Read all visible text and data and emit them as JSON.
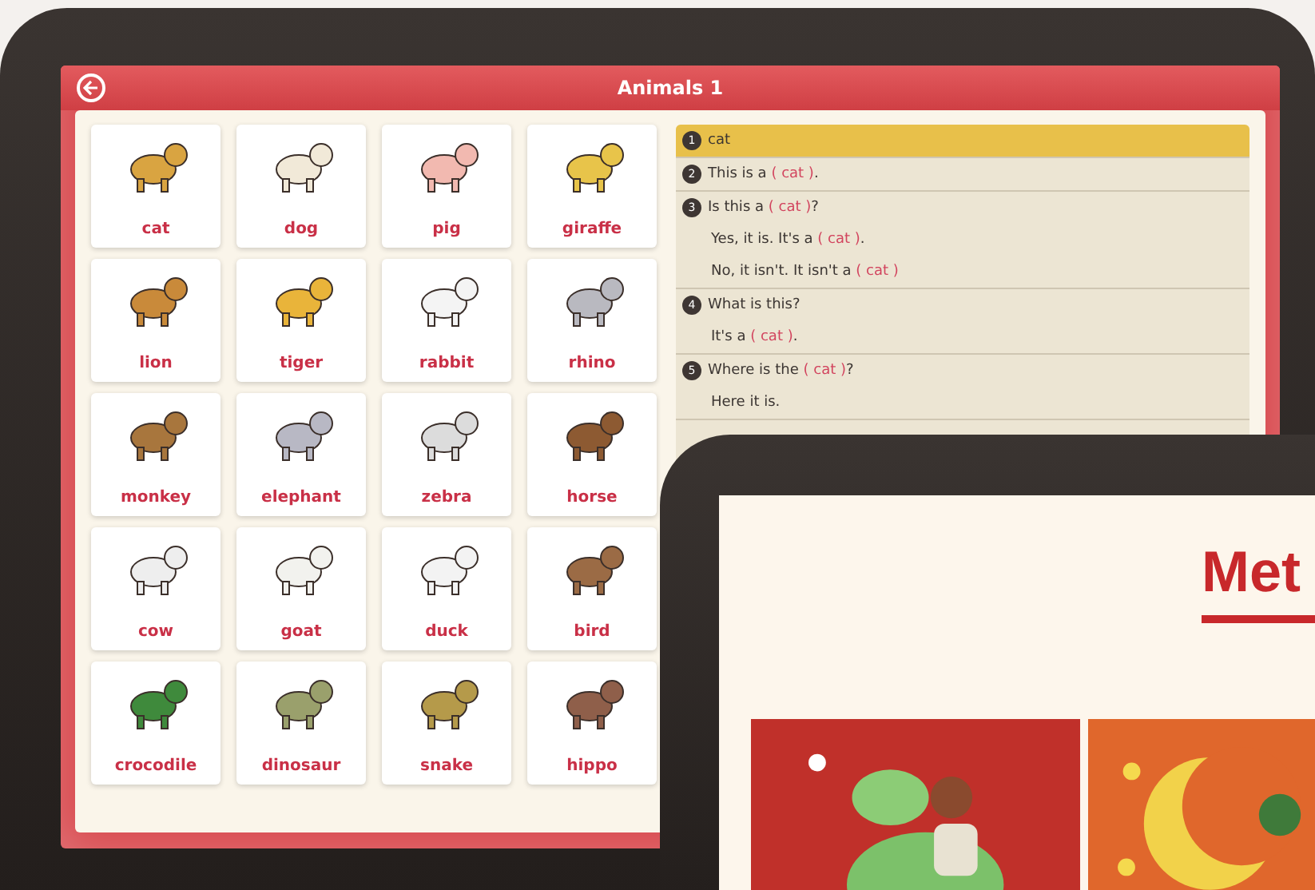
{
  "main_tablet": {
    "header": {
      "title": "Animals 1"
    },
    "cards": [
      {
        "label": "cat"
      },
      {
        "label": "dog"
      },
      {
        "label": "pig"
      },
      {
        "label": "giraffe"
      },
      {
        "label": "lion"
      },
      {
        "label": "tiger"
      },
      {
        "label": "rabbit"
      },
      {
        "label": "rhino"
      },
      {
        "label": "monkey"
      },
      {
        "label": "elephant"
      },
      {
        "label": "zebra"
      },
      {
        "label": "horse"
      },
      {
        "label": "cow"
      },
      {
        "label": "goat"
      },
      {
        "label": "duck"
      },
      {
        "label": "bird"
      },
      {
        "label": "crocodile"
      },
      {
        "label": "dinosaur"
      },
      {
        "label": "snake"
      },
      {
        "label": "hippo"
      }
    ],
    "phrases": [
      {
        "number": "1",
        "selected": true,
        "lines": [
          {
            "text": "cat"
          }
        ]
      },
      {
        "number": "2",
        "selected": false,
        "lines": [
          {
            "text": "This is a",
            "blank": "( cat )",
            "end": "."
          }
        ]
      },
      {
        "number": "3",
        "selected": false,
        "lines": [
          {
            "text": "Is this a",
            "blank": "( cat )",
            "end": "?"
          },
          {
            "text": "Yes, it is. It's a",
            "blank": "( cat )",
            "end": "."
          },
          {
            "text": "No, it isn't. It isn't a",
            "blank": "( cat )"
          }
        ]
      },
      {
        "number": "4",
        "selected": false,
        "lines": [
          {
            "text": "What is this?"
          },
          {
            "text": "It's a",
            "blank": "( cat )",
            "end": "."
          }
        ]
      },
      {
        "number": "5",
        "selected": false,
        "lines": [
          {
            "text": "Where is the",
            "blank": "( cat )",
            "end": "?"
          },
          {
            "text": "Here it is."
          }
        ]
      }
    ]
  },
  "second_tablet": {
    "title": "Met"
  }
}
